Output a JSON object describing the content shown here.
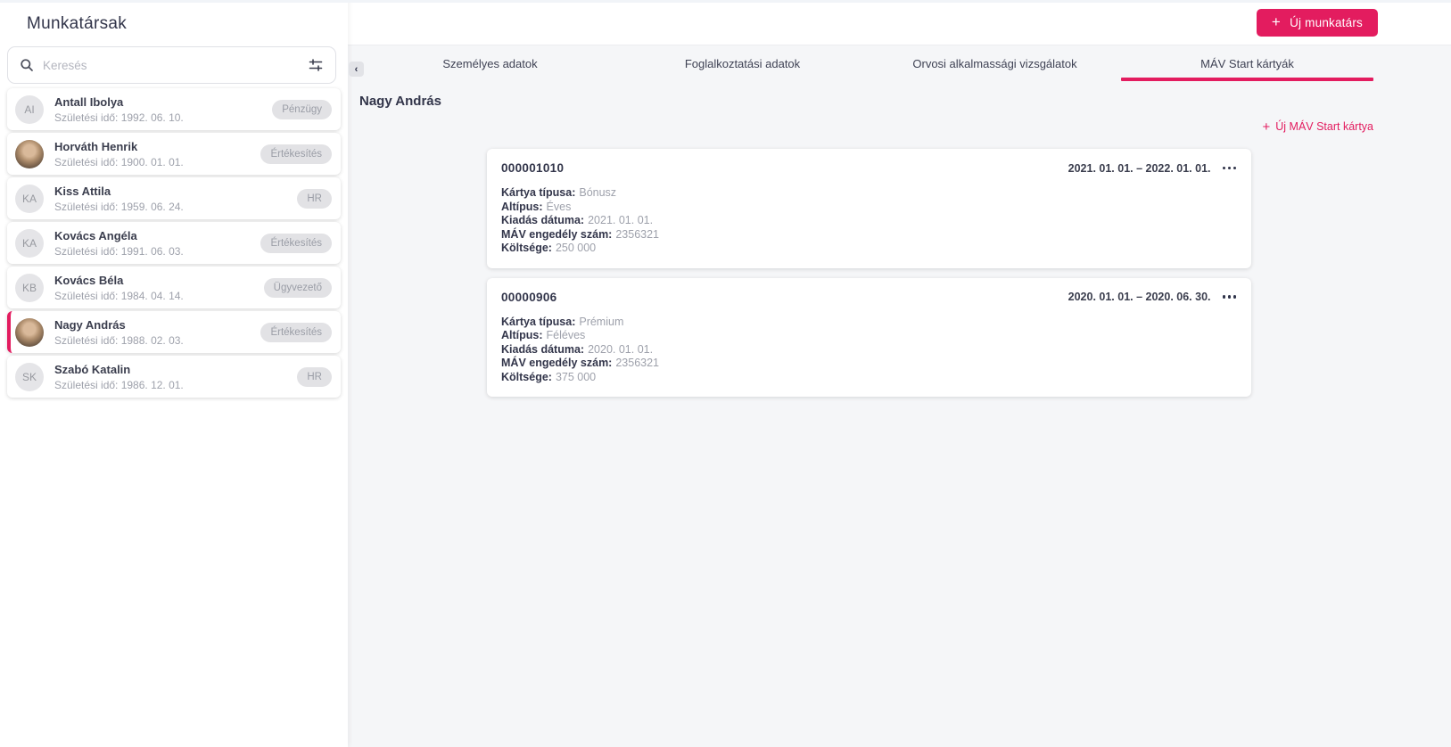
{
  "colors": {
    "accent": "#E31C5F"
  },
  "sidebar": {
    "title": "Munkatársak",
    "search": {
      "placeholder": "Keresés"
    },
    "employees": [
      {
        "initials": "AI",
        "photo": false,
        "selected": false,
        "name": "Antall Ibolya",
        "birth": "Születési idő: 1992. 06. 10.",
        "badge": "Pénzügy"
      },
      {
        "initials": "",
        "photo": true,
        "selected": false,
        "name": "Horváth Henrik",
        "birth": "Születési idő: 1900. 01. 01.",
        "badge": "Értékesítés"
      },
      {
        "initials": "KA",
        "photo": false,
        "selected": false,
        "name": "Kiss Attila",
        "birth": "Születési idő: 1959. 06. 24.",
        "badge": "HR"
      },
      {
        "initials": "KA",
        "photo": false,
        "selected": false,
        "name": "Kovács Angéla",
        "birth": "Születési idő: 1991. 06. 03.",
        "badge": "Értékesítés"
      },
      {
        "initials": "KB",
        "photo": false,
        "selected": false,
        "name": "Kovács Béla",
        "birth": "Születési idő: 1984. 04. 14.",
        "badge": "Ügyvezető"
      },
      {
        "initials": "",
        "photo": true,
        "selected": true,
        "name": "Nagy András",
        "birth": "Születési idő: 1988. 02. 03.",
        "badge": "Értékesítés"
      },
      {
        "initials": "SK",
        "photo": false,
        "selected": false,
        "name": "Szabó Katalin",
        "birth": "Születési idő: 1986. 12. 01.",
        "badge": "HR"
      }
    ]
  },
  "toolbar": {
    "new_employee_label": "Új munkatárs",
    "plus": "+"
  },
  "tabs": [
    {
      "label": "Személyes adatok",
      "active": false
    },
    {
      "label": "Foglalkoztatási adatok",
      "active": false
    },
    {
      "label": "Orvosi alkalmassági vizsgálatok",
      "active": false
    },
    {
      "label": "MÁV Start kártyák",
      "active": true
    }
  ],
  "content": {
    "employee_name": "Nagy András",
    "new_card_label": "Új MÁV Start kártya",
    "cards": [
      {
        "number": "000001010",
        "validity": "2021. 01. 01. – 2022. 01. 01.",
        "fields": [
          {
            "label": "Kártya típusa:",
            "value": "Bónusz"
          },
          {
            "label": "Altípus:",
            "value": "Éves"
          },
          {
            "label": "Kiadás dátuma:",
            "value": "2021. 01. 01."
          },
          {
            "label": "MÁV engedély szám:",
            "value": "2356321"
          },
          {
            "label": "Költsége:",
            "value": "250 000"
          }
        ]
      },
      {
        "number": "00000906",
        "validity": "2020. 01. 01. – 2020. 06. 30.",
        "fields": [
          {
            "label": "Kártya típusa:",
            "value": "Prémium"
          },
          {
            "label": "Altípus:",
            "value": "Féléves"
          },
          {
            "label": "Kiadás dátuma:",
            "value": "2020. 01. 01."
          },
          {
            "label": "MÁV engedély szám:",
            "value": "2356321"
          },
          {
            "label": "Költsége:",
            "value": "375 000"
          }
        ]
      }
    ]
  }
}
